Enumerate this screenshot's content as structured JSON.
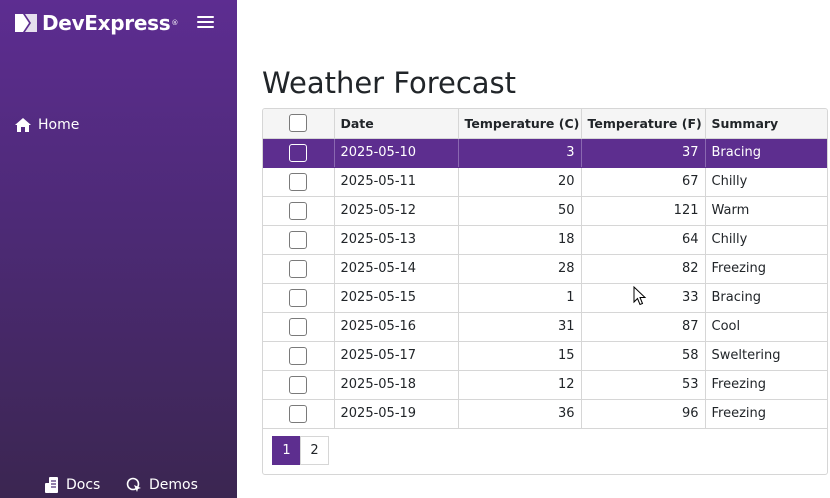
{
  "sidebar": {
    "brand": {
      "name": "DevExpress",
      "reg": "®"
    },
    "nav": [
      {
        "label": "Home",
        "icon": "home-icon"
      }
    ],
    "footer": [
      {
        "label": "Docs",
        "icon": "docs-icon"
      },
      {
        "label": "Demos",
        "icon": "demos-icon"
      }
    ]
  },
  "main": {
    "title": "Weather Forecast",
    "grid": {
      "columns": [
        "Date",
        "Temperature (C)",
        "Temperature (F)",
        "Summary"
      ],
      "rows": [
        {
          "date": "2025-05-10",
          "tc": "3",
          "tf": "37",
          "summary": "Bracing",
          "selected": true
        },
        {
          "date": "2025-05-11",
          "tc": "20",
          "tf": "67",
          "summary": "Chilly",
          "selected": false
        },
        {
          "date": "2025-05-12",
          "tc": "50",
          "tf": "121",
          "summary": "Warm",
          "selected": false
        },
        {
          "date": "2025-05-13",
          "tc": "18",
          "tf": "64",
          "summary": "Chilly",
          "selected": false
        },
        {
          "date": "2025-05-14",
          "tc": "28",
          "tf": "82",
          "summary": "Freezing",
          "selected": false
        },
        {
          "date": "2025-05-15",
          "tc": "1",
          "tf": "33",
          "summary": "Bracing",
          "selected": false
        },
        {
          "date": "2025-05-16",
          "tc": "31",
          "tf": "87",
          "summary": "Cool",
          "selected": false
        },
        {
          "date": "2025-05-17",
          "tc": "15",
          "tf": "58",
          "summary": "Sweltering",
          "selected": false
        },
        {
          "date": "2025-05-18",
          "tc": "12",
          "tf": "53",
          "summary": "Freezing",
          "selected": false
        },
        {
          "date": "2025-05-19",
          "tc": "36",
          "tf": "96",
          "summary": "Freezing",
          "selected": false
        }
      ]
    },
    "pager": {
      "pages": [
        "1",
        "2"
      ],
      "current": "1"
    }
  },
  "colors": {
    "accent": "#5d2e8f",
    "sidebar_top": "#5d2d91",
    "sidebar_bottom": "#3b2651"
  }
}
